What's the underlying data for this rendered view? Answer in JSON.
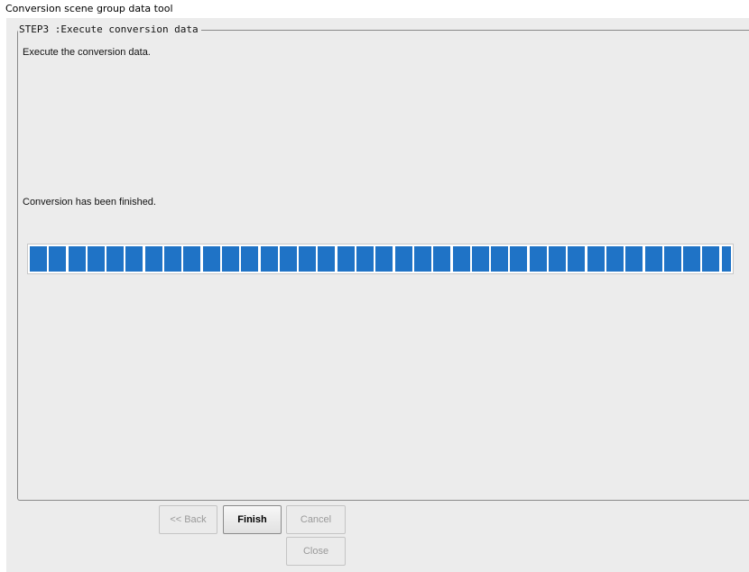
{
  "window": {
    "title": "Conversion scene group data tool"
  },
  "step": {
    "legend": "STEP3 :Execute conversion data",
    "description": "Execute the conversion data.",
    "status": "Conversion has been finished.",
    "progress_percent": 100
  },
  "buttons": {
    "back": "<< Back",
    "finish": "Finish",
    "cancel": "Cancel",
    "close": "Close"
  },
  "colors": {
    "progress_fill": "#1f73c6",
    "background": "#ececec"
  }
}
